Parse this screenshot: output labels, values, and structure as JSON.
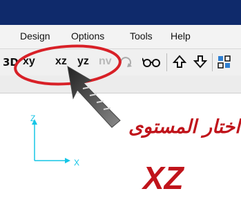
{
  "menu": {
    "items": [
      "Design",
      "Options",
      "Tools",
      "Help"
    ]
  },
  "toolbar": {
    "view_buttons": [
      "xy",
      "xz",
      "yz",
      "nv"
    ],
    "icons": [
      "3d-view-icon",
      "rotate-view-icon",
      "glasses-icon",
      "arrow-up-icon",
      "arrow-down-icon",
      "grid-icon"
    ]
  },
  "axes": {
    "vertical_label": "Z",
    "horizontal_label": "X",
    "color": "#14c5e6"
  },
  "annotation": {
    "arabic_text": "اختار المستوى",
    "plane_label": "XZ",
    "color": "#c0141b",
    "highlight": "ellipse around xz button with pointer arrow"
  }
}
